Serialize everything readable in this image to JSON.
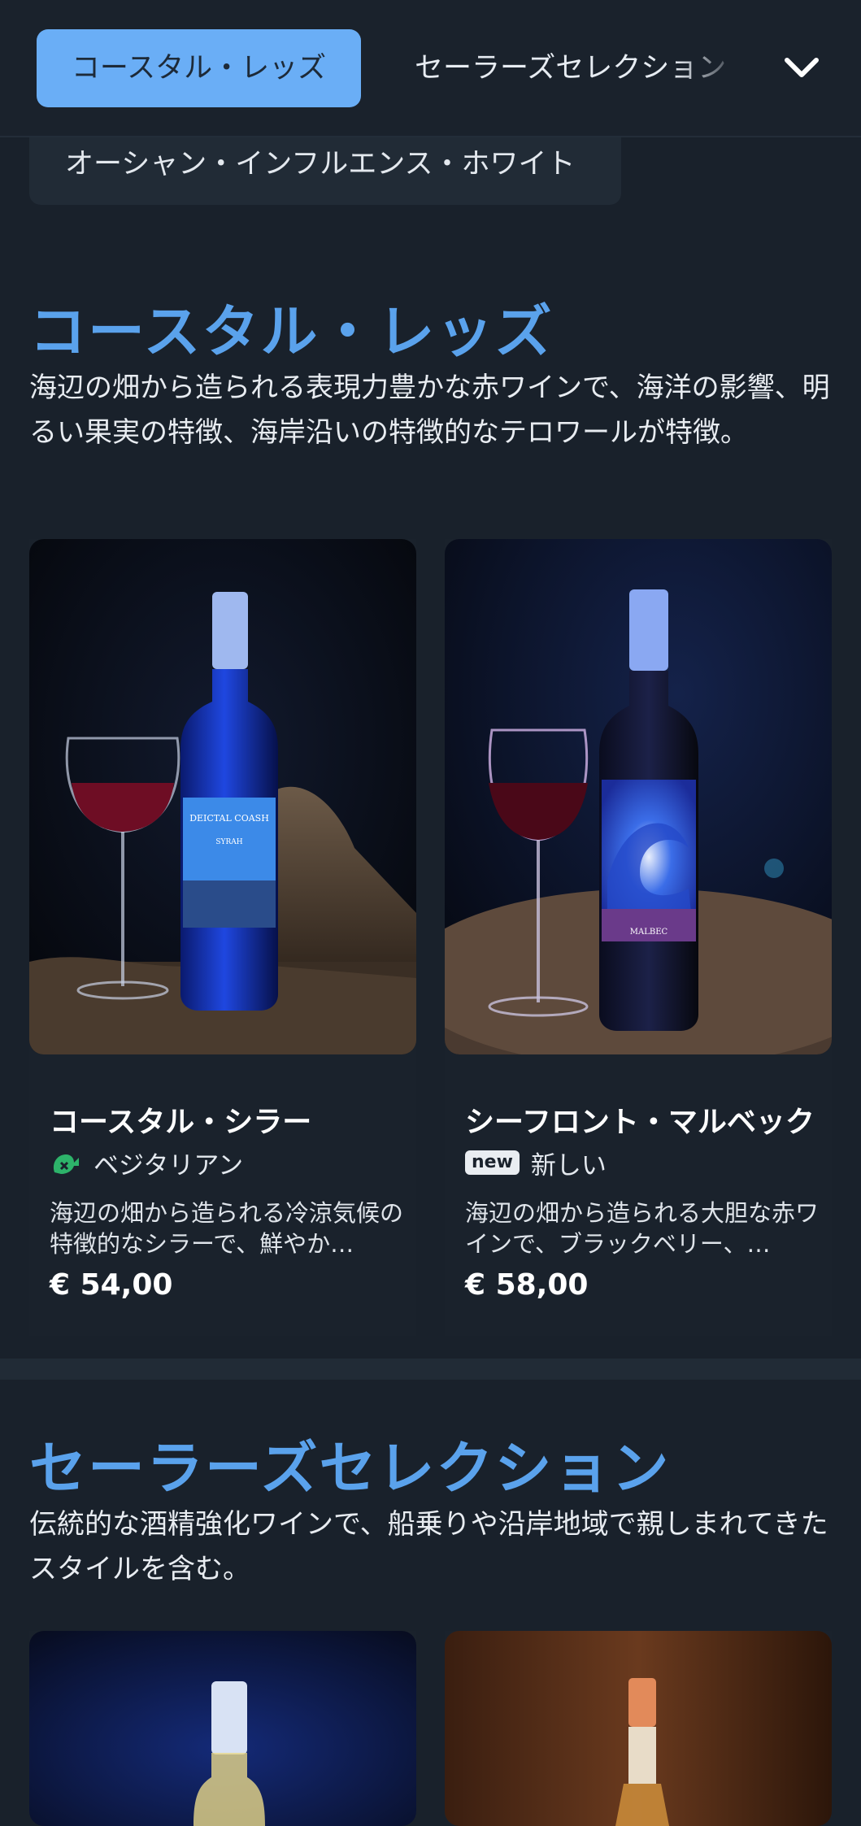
{
  "nav": {
    "active_tab": "コースタル・レッズ",
    "next_tab": "セーラーズセレクション",
    "expand_icon": "chevron-down-icon"
  },
  "category_chip": "オーシャン・インフルエンス・ホワイト",
  "sections": [
    {
      "title": "コースタル・レッズ",
      "description": "海辺の畑から造られる表現力豊かな赤ワインで、海洋の影響、明るい果実の特徴、海岸沿いの特徴的なテロワールが特徴。",
      "products": [
        {
          "name": "コースタル・シラー",
          "tag": "ベジタリアン",
          "tag_icon": "vegetarian-icon",
          "description": "海辺の畑から造られる冷涼気候の特徴的なシラーで、鮮やか…",
          "price": "€ 54,00",
          "label_text": "DEICTAL COASH",
          "label_sub": "SYRAH"
        },
        {
          "name": "シーフロント・マルベック",
          "badge": "new",
          "tag": "新しい",
          "description": "海辺の畑から造られる大胆な赤ワインで、ブラックベリー、…",
          "price": "€ 58,00",
          "label_sub": "MALBEC"
        }
      ]
    },
    {
      "title": "セーラーズセレクション",
      "description": "伝統的な酒精強化ワインで、船乗りや沿岸地域で親しまれてきたスタイルを含む。"
    }
  ],
  "colors": {
    "background": "#19212b",
    "accent": "#5aa2ec",
    "active_pill": "#6aaef6"
  }
}
